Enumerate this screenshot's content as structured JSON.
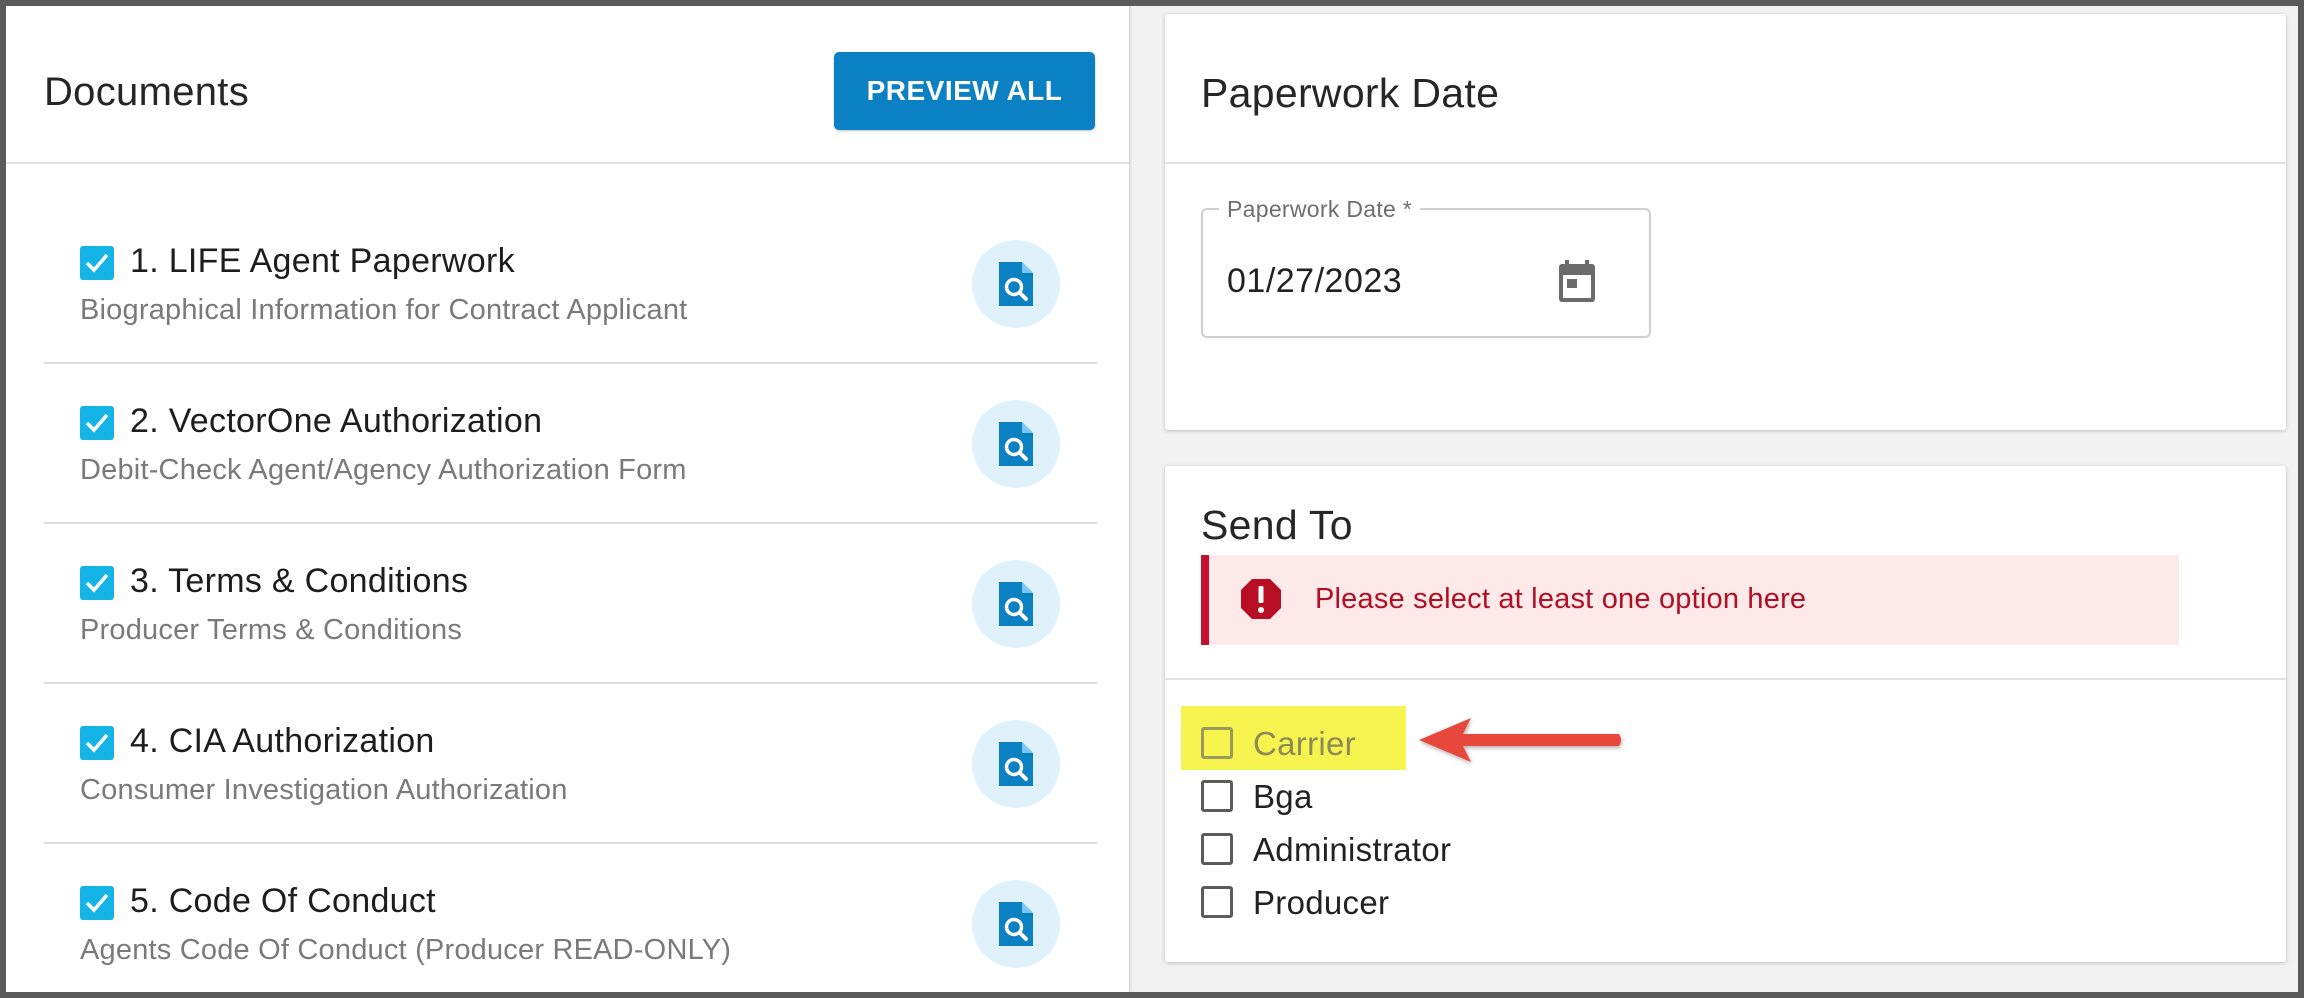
{
  "documents": {
    "title": "Documents",
    "preview_all_label": "PREVIEW ALL",
    "items": [
      {
        "title": "1. LIFE Agent Paperwork",
        "subtitle": "Biographical Information for Contract Applicant",
        "checked": true
      },
      {
        "title": "2. VectorOne Authorization",
        "subtitle": "Debit-Check Agent/Agency Authorization Form",
        "checked": true
      },
      {
        "title": "3. Terms & Conditions",
        "subtitle": "Producer Terms & Conditions",
        "checked": true
      },
      {
        "title": "4. CIA Authorization",
        "subtitle": "Consumer Investigation Authorization",
        "checked": true
      },
      {
        "title": "5. Code Of Conduct",
        "subtitle": "Agents Code Of Conduct (Producer READ-ONLY)",
        "checked": true
      }
    ]
  },
  "paperwork_date": {
    "title": "Paperwork Date",
    "field_label": "Paperwork Date *",
    "field_value": "01/27/2023",
    "calendar_icon": "calendar-icon"
  },
  "send_to": {
    "title": "Send To",
    "alert_icon": "error-icon",
    "alert_text": "Please select at least one option here",
    "options": [
      {
        "label": "Carrier",
        "checked": false
      },
      {
        "label": "Bga",
        "checked": false
      },
      {
        "label": "Administrator",
        "checked": false
      },
      {
        "label": "Producer",
        "checked": false
      }
    ]
  },
  "colors": {
    "accent": "#0b80c2",
    "checkbox": "#14b5e6",
    "error": "#c8102e",
    "alert_bg": "#fde9e9",
    "highlight": "#f7f44f",
    "annotation_arrow": "#e8463e"
  }
}
